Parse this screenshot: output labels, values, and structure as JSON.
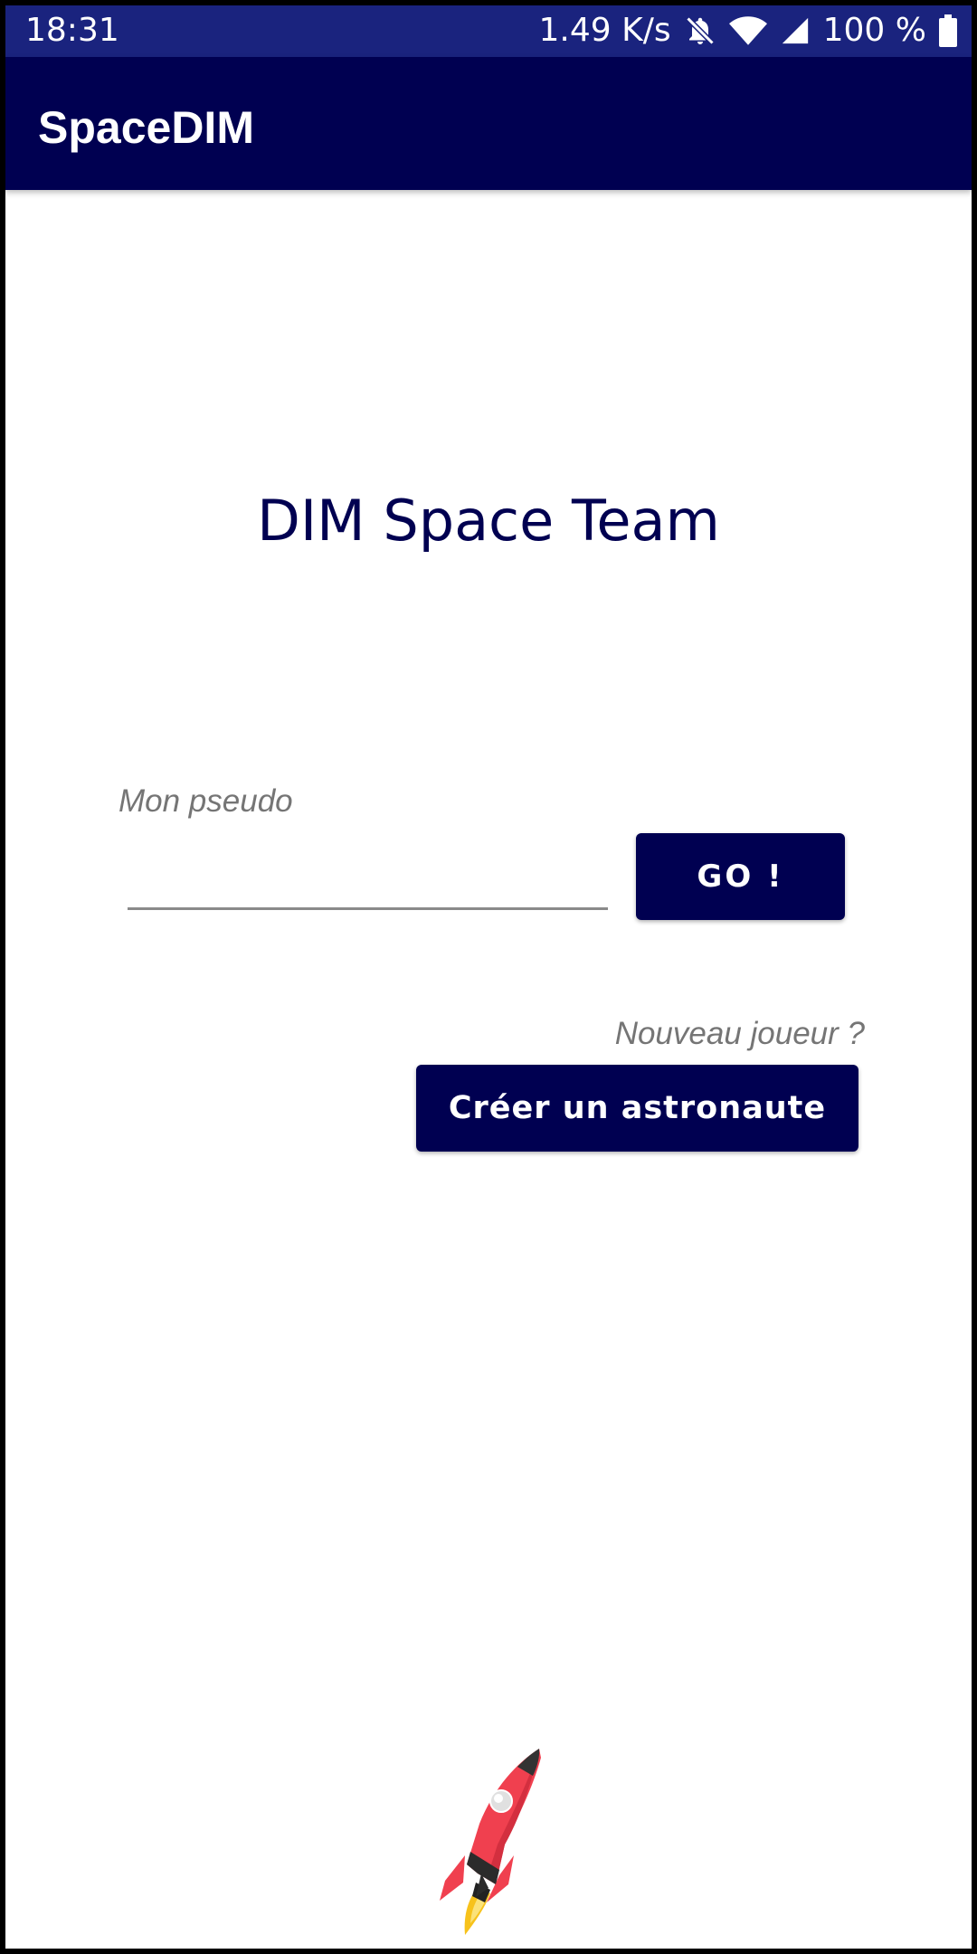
{
  "status_bar": {
    "time": "18:31",
    "network_speed": "1.49 K/s",
    "battery": "100 %",
    "icons": [
      "bell-off-icon",
      "wifi-icon",
      "signal-icon",
      "battery-icon"
    ]
  },
  "app_bar": {
    "title": "SpaceDIM"
  },
  "main": {
    "title": "DIM Space Team",
    "pseudo_label": "Mon pseudo",
    "pseudo_value": "",
    "go_label": "GO !",
    "new_player_label": "Nouveau joueur ?",
    "create_label": "Créer un astronaute",
    "logo_icon": "rocket-icon"
  },
  "colors": {
    "status_bar": "#1a237e",
    "primary_dark": "#000051",
    "hint_text": "#757575",
    "background": "#ffffff",
    "rocket_body": "#f0404f",
    "rocket_flame": "#f7c21b"
  }
}
